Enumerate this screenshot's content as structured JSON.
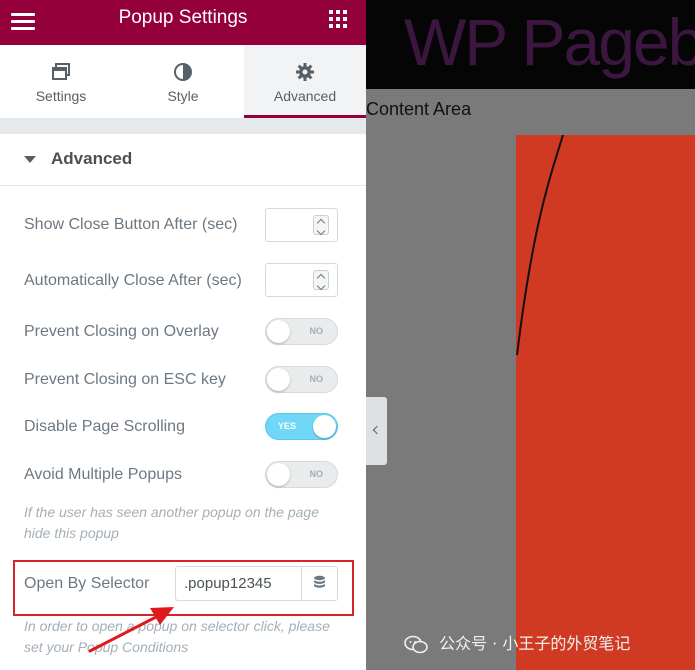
{
  "header": {
    "title": "Popup Settings",
    "accent_color": "#93003a"
  },
  "tabs": [
    {
      "label": "Settings",
      "icon": "window-icon",
      "active": false
    },
    {
      "label": "Style",
      "icon": "contrast-icon",
      "active": false
    },
    {
      "label": "Advanced",
      "icon": "gear-icon",
      "active": true
    }
  ],
  "section": {
    "title": "Advanced"
  },
  "settings": {
    "show_close_after": {
      "label": "Show Close Button After (sec)",
      "value": ""
    },
    "auto_close_after": {
      "label": "Automatically Close After (sec)",
      "value": ""
    },
    "prevent_overlay": {
      "label": "Prevent Closing on Overlay",
      "state": "NO"
    },
    "prevent_esc": {
      "label": "Prevent Closing on ESC key",
      "state": "NO"
    },
    "disable_scrolling": {
      "label": "Disable Page Scrolling",
      "state": "YES"
    },
    "avoid_multiple": {
      "label": "Avoid Multiple Popups",
      "state": "NO"
    },
    "avoid_multiple_help": "If the user has seen another popup on the page hide this popup",
    "open_by_selector": {
      "label": "Open By Selector",
      "value": ".popup12345",
      "icon": "database-icon"
    },
    "selector_help": "In order to open a popup on selector click, please set your Popup Conditions"
  },
  "canvas": {
    "site_title": "WP Pageb",
    "content_label": "Content Area",
    "highlight_color": "#d5232b"
  },
  "watermark": {
    "text": "公众号 · 小王子的外贸笔记"
  }
}
